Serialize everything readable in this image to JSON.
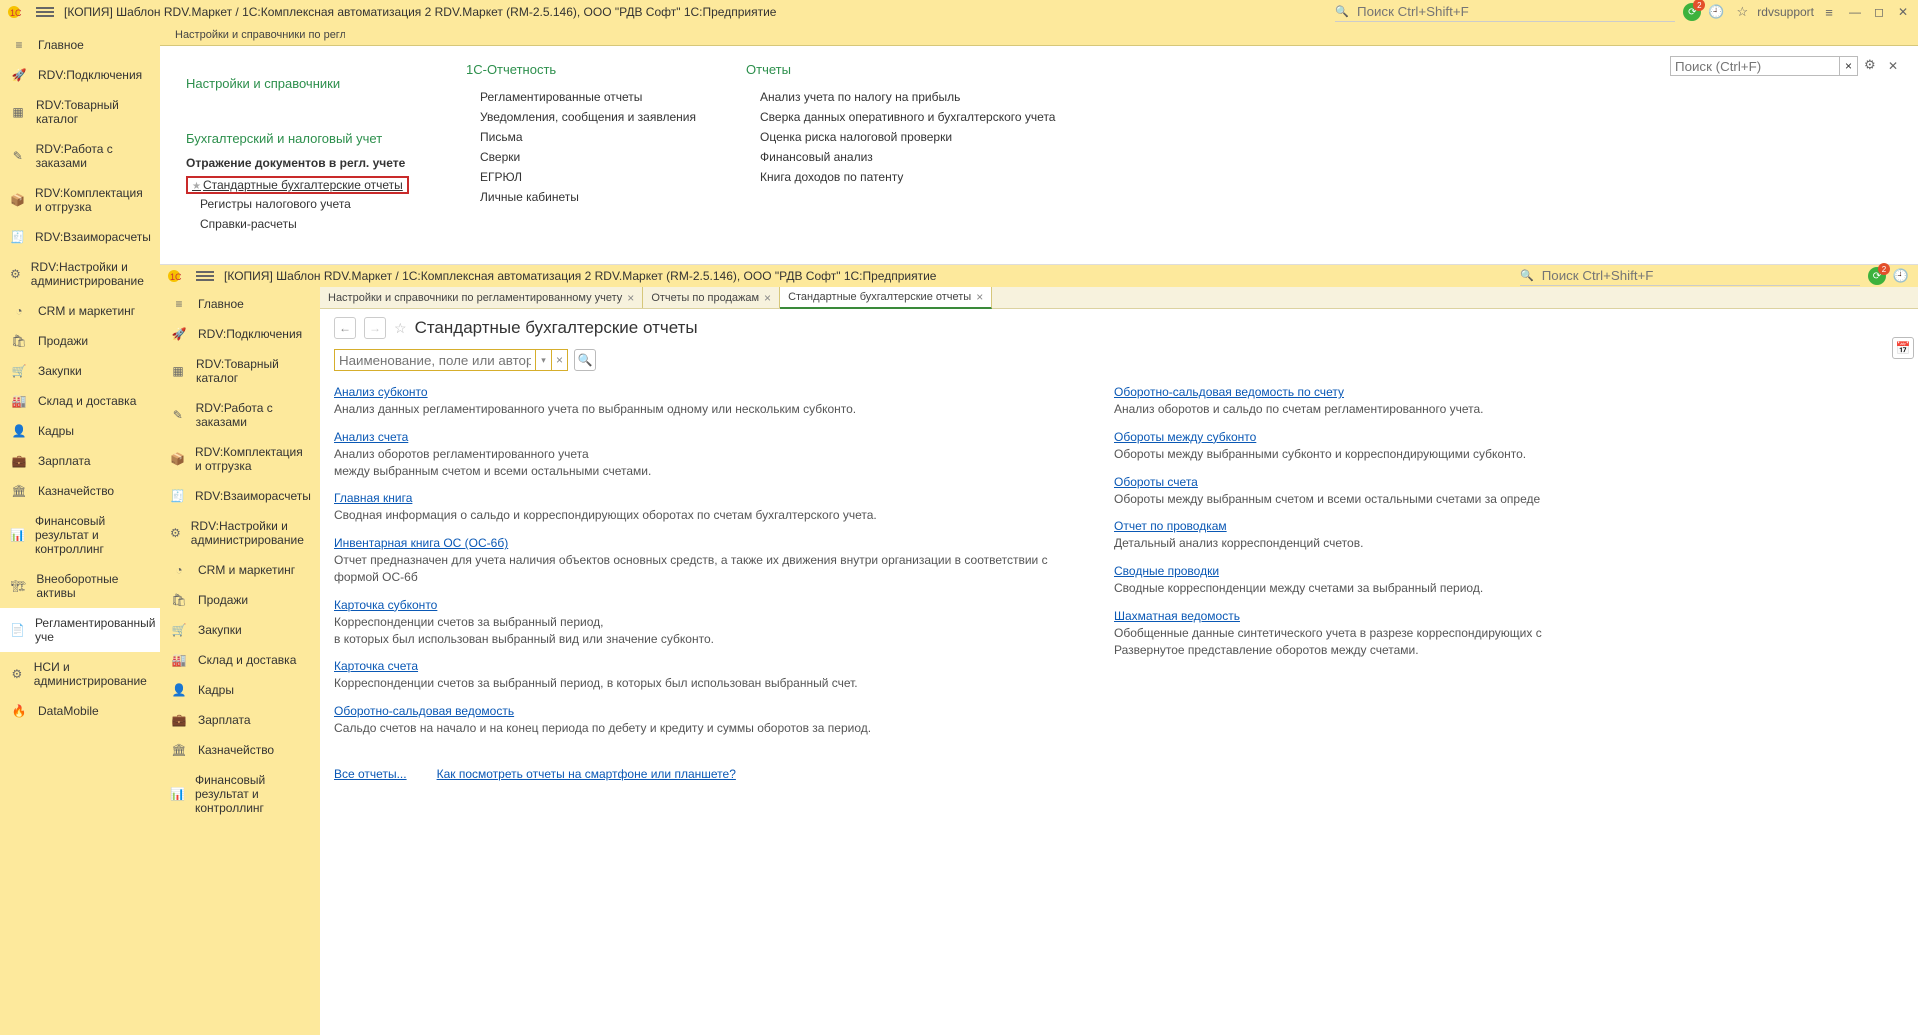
{
  "title": "[КОПИЯ] Шаблон RDV.Маркет / 1С:Комплексная автоматизация 2 RDV.Маркет (RM-2.5.146), ООО \"РДВ Софт\" 1С:Предприятие",
  "top_search_placeholder": "Поиск Ctrl+Shift+F",
  "notif_badge": "2",
  "user": "rdvsupport",
  "tab1": "Настройки и справочники по реглам",
  "menu_search_placeholder": "Поиск (Ctrl+F)",
  "sidebar": [
    {
      "icon": "≡",
      "label": "Главное"
    },
    {
      "icon": "🚀",
      "label": "RDV:Подключения"
    },
    {
      "icon": "▦",
      "label": "RDV:Товарный каталог"
    },
    {
      "icon": "✎",
      "label": "RDV:Работа с заказами"
    },
    {
      "icon": "📦",
      "label": "RDV:Комплектация и отгрузка"
    },
    {
      "icon": "🧾",
      "label": "RDV:Взаиморасчеты"
    },
    {
      "icon": "⚙",
      "label": "RDV:Настройки и администрирование"
    },
    {
      "icon": "◔",
      "label": "CRM и маркетинг"
    },
    {
      "icon": "🛍",
      "label": "Продажи"
    },
    {
      "icon": "🛒",
      "label": "Закупки"
    },
    {
      "icon": "🏭",
      "label": "Склад и доставка"
    },
    {
      "icon": "👤",
      "label": "Кадры"
    },
    {
      "icon": "💼",
      "label": "Зарплата"
    },
    {
      "icon": "🏛",
      "label": "Казначейство"
    },
    {
      "icon": "📊",
      "label": "Финансовый результат и контроллинг"
    },
    {
      "icon": "🏗",
      "label": "Внеоборотные активы"
    },
    {
      "icon": "📄",
      "label": "Регламентированный уче"
    },
    {
      "icon": "⚙",
      "label": "НСИ и администрирование"
    },
    {
      "icon": "🔥",
      "label": "DataMobile"
    }
  ],
  "menu": {
    "col1_head1": "Настройки и справочники",
    "col1_head2": "Бухгалтерский и налоговый учет",
    "col1_sub": "Отражение документов в регл. учете",
    "col1_hl": "Стандартные бухгалтерские отчеты",
    "col1_l3": "Регистры налогового учета",
    "col1_l4": "Справки-расчеты",
    "col2_head": "1С-Отчетность",
    "col2_l1": "Регламентированные отчеты",
    "col2_l2": "Уведомления, сообщения и заявления",
    "col2_l3": "Письма",
    "col2_l4": "Сверки",
    "col2_l5": "ЕГРЮЛ",
    "col2_l6": "Личные кабинеты",
    "col3_head": "Отчеты",
    "col3_l1": "Анализ учета по налогу на прибыль",
    "col3_l2": "Сверка данных оперативного и бухгалтерского учета",
    "col3_l3": "Оценка риска налоговой проверки",
    "col3_l4": "Финансовый анализ",
    "col3_l5": "Книга доходов по патенту"
  },
  "inner": {
    "title": "[КОПИЯ] Шаблон RDV.Маркет / 1С:Комплексная автоматизация 2 RDV.Маркет (RM-2.5.146), ООО \"РДВ Софт\" 1С:Предприятие",
    "search_placeholder": "Поиск Ctrl+Shift+F",
    "tabs": {
      "t1": "Настройки и справочники по регламентированному учету",
      "t2": "Отчеты по продажам",
      "t3": "Стандартные бухгалтерские отчеты"
    },
    "sidebar": [
      {
        "icon": "≡",
        "label": "Главное"
      },
      {
        "icon": "🚀",
        "label": "RDV:Подключения"
      },
      {
        "icon": "▦",
        "label": "RDV:Товарный каталог"
      },
      {
        "icon": "✎",
        "label": "RDV:Работа с заказами"
      },
      {
        "icon": "📦",
        "label": "RDV:Комплектация и отгрузка"
      },
      {
        "icon": "🧾",
        "label": "RDV:Взаиморасчеты"
      },
      {
        "icon": "⚙",
        "label": "RDV:Настройки и администрирование"
      },
      {
        "icon": "◔",
        "label": "CRM и маркетинг"
      },
      {
        "icon": "🛍",
        "label": "Продажи"
      },
      {
        "icon": "🛒",
        "label": "Закупки"
      },
      {
        "icon": "🏭",
        "label": "Склад и доставка"
      },
      {
        "icon": "👤",
        "label": "Кадры"
      },
      {
        "icon": "💼",
        "label": "Зарплата"
      },
      {
        "icon": "🏛",
        "label": "Казначейство"
      },
      {
        "icon": "📊",
        "label": "Финансовый результат и контроллинг"
      }
    ],
    "form_title": "Стандартные бухгалтерские отчеты",
    "filter_placeholder": "Наименование, поле или автор отчета",
    "reportsL": [
      {
        "t": "Анализ субконто",
        "d": "Анализ данных регламентированного учета по выбранным одному или нескольким субконто."
      },
      {
        "t": "Анализ счета",
        "d": "Анализ оборотов регламентированного учета\nмежду выбранным счетом и всеми остальными счетами."
      },
      {
        "t": "Главная книга",
        "d": "Сводная информация о сальдо и корреспондирующих оборотах по счетам бухгалтерского учета."
      },
      {
        "t": "Инвентарная книга ОС (ОС-6б)",
        "d": "Отчет предназначен для учета наличия объектов основных средств, а также их движения внутри организации в соответствии с формой ОС-6б"
      },
      {
        "t": "Карточка субконто",
        "d": "Корреспонденции счетов за выбранный период,\nв которых был использован выбранный вид  или значение субконто."
      },
      {
        "t": "Карточка счета",
        "d": "Корреспонденции счетов за выбранный период, в которых был использован выбранный счет."
      },
      {
        "t": "Оборотно-сальдовая ведомость",
        "d": "Сальдо счетов на начало и на конец периода по дебету и кредиту и суммы оборотов за период."
      }
    ],
    "reportsR": [
      {
        "t": "Оборотно-сальдовая ведомость по счету",
        "d": "Анализ оборотов и сальдо по счетам регламентированного учета."
      },
      {
        "t": "Обороты между субконто",
        "d": "Обороты между выбранными субконто и корреспондирующими субконто."
      },
      {
        "t": "Обороты счета",
        "d": "Обороты между выбранным счетом и всеми остальными счетами за опреде"
      },
      {
        "t": "Отчет по проводкам",
        "d": "Детальный анализ корреспонденций счетов."
      },
      {
        "t": "Сводные проводки",
        "d": "Сводные корреспонденции между счетами за выбранный период."
      },
      {
        "t": "Шахматная ведомость",
        "d": "Обобщенные данные синтетического учета в разрезе корреспондирующих с\nРазвернутое представление оборотов между счетами."
      }
    ],
    "bottom1": "Все отчеты...",
    "bottom2": "Как посмотреть отчеты на смартфоне или планшете?"
  }
}
